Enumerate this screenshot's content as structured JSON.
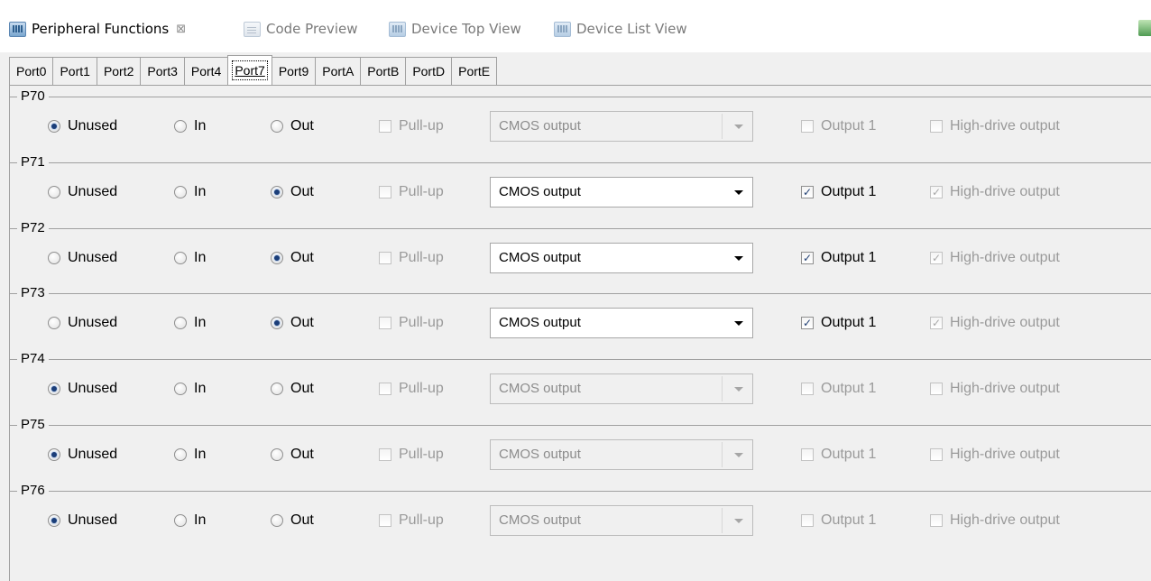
{
  "editor_tabs": [
    {
      "label": "Peripheral Functions",
      "icon": "peripheral-icon",
      "active": true,
      "closable": true
    },
    {
      "label": "Code Preview",
      "icon": "code-preview-icon",
      "active": false
    },
    {
      "label": "Device Top View",
      "icon": "device-top-icon",
      "active": false
    },
    {
      "label": "Device List View",
      "icon": "device-list-icon",
      "active": false
    }
  ],
  "close_glyph": "⊠",
  "port_tabs": [
    "Port0",
    "Port1",
    "Port2",
    "Port3",
    "Port4",
    "Port7",
    "Port9",
    "PortA",
    "PortB",
    "PortD",
    "PortE"
  ],
  "active_port": "Port7",
  "labels": {
    "unused": "Unused",
    "in": "In",
    "out": "Out",
    "pullup": "Pull-up",
    "output1": "Output 1",
    "high_drive": "High-drive output"
  },
  "check_glyph": "✓",
  "pins": [
    {
      "name": "P70",
      "mode": "Unused",
      "output_type": "CMOS output",
      "output1": false,
      "high_drive": false
    },
    {
      "name": "P71",
      "mode": "Out",
      "output_type": "CMOS output",
      "output1": true,
      "high_drive": true
    },
    {
      "name": "P72",
      "mode": "Out",
      "output_type": "CMOS output",
      "output1": true,
      "high_drive": true
    },
    {
      "name": "P73",
      "mode": "Out",
      "output_type": "CMOS output",
      "output1": true,
      "high_drive": true
    },
    {
      "name": "P74",
      "mode": "Unused",
      "output_type": "CMOS output",
      "output1": false,
      "high_drive": false
    },
    {
      "name": "P75",
      "mode": "Unused",
      "output_type": "CMOS output",
      "output1": false,
      "high_drive": false
    },
    {
      "name": "P76",
      "mode": "Unused",
      "output_type": "CMOS output",
      "output1": false,
      "high_drive": false
    }
  ]
}
